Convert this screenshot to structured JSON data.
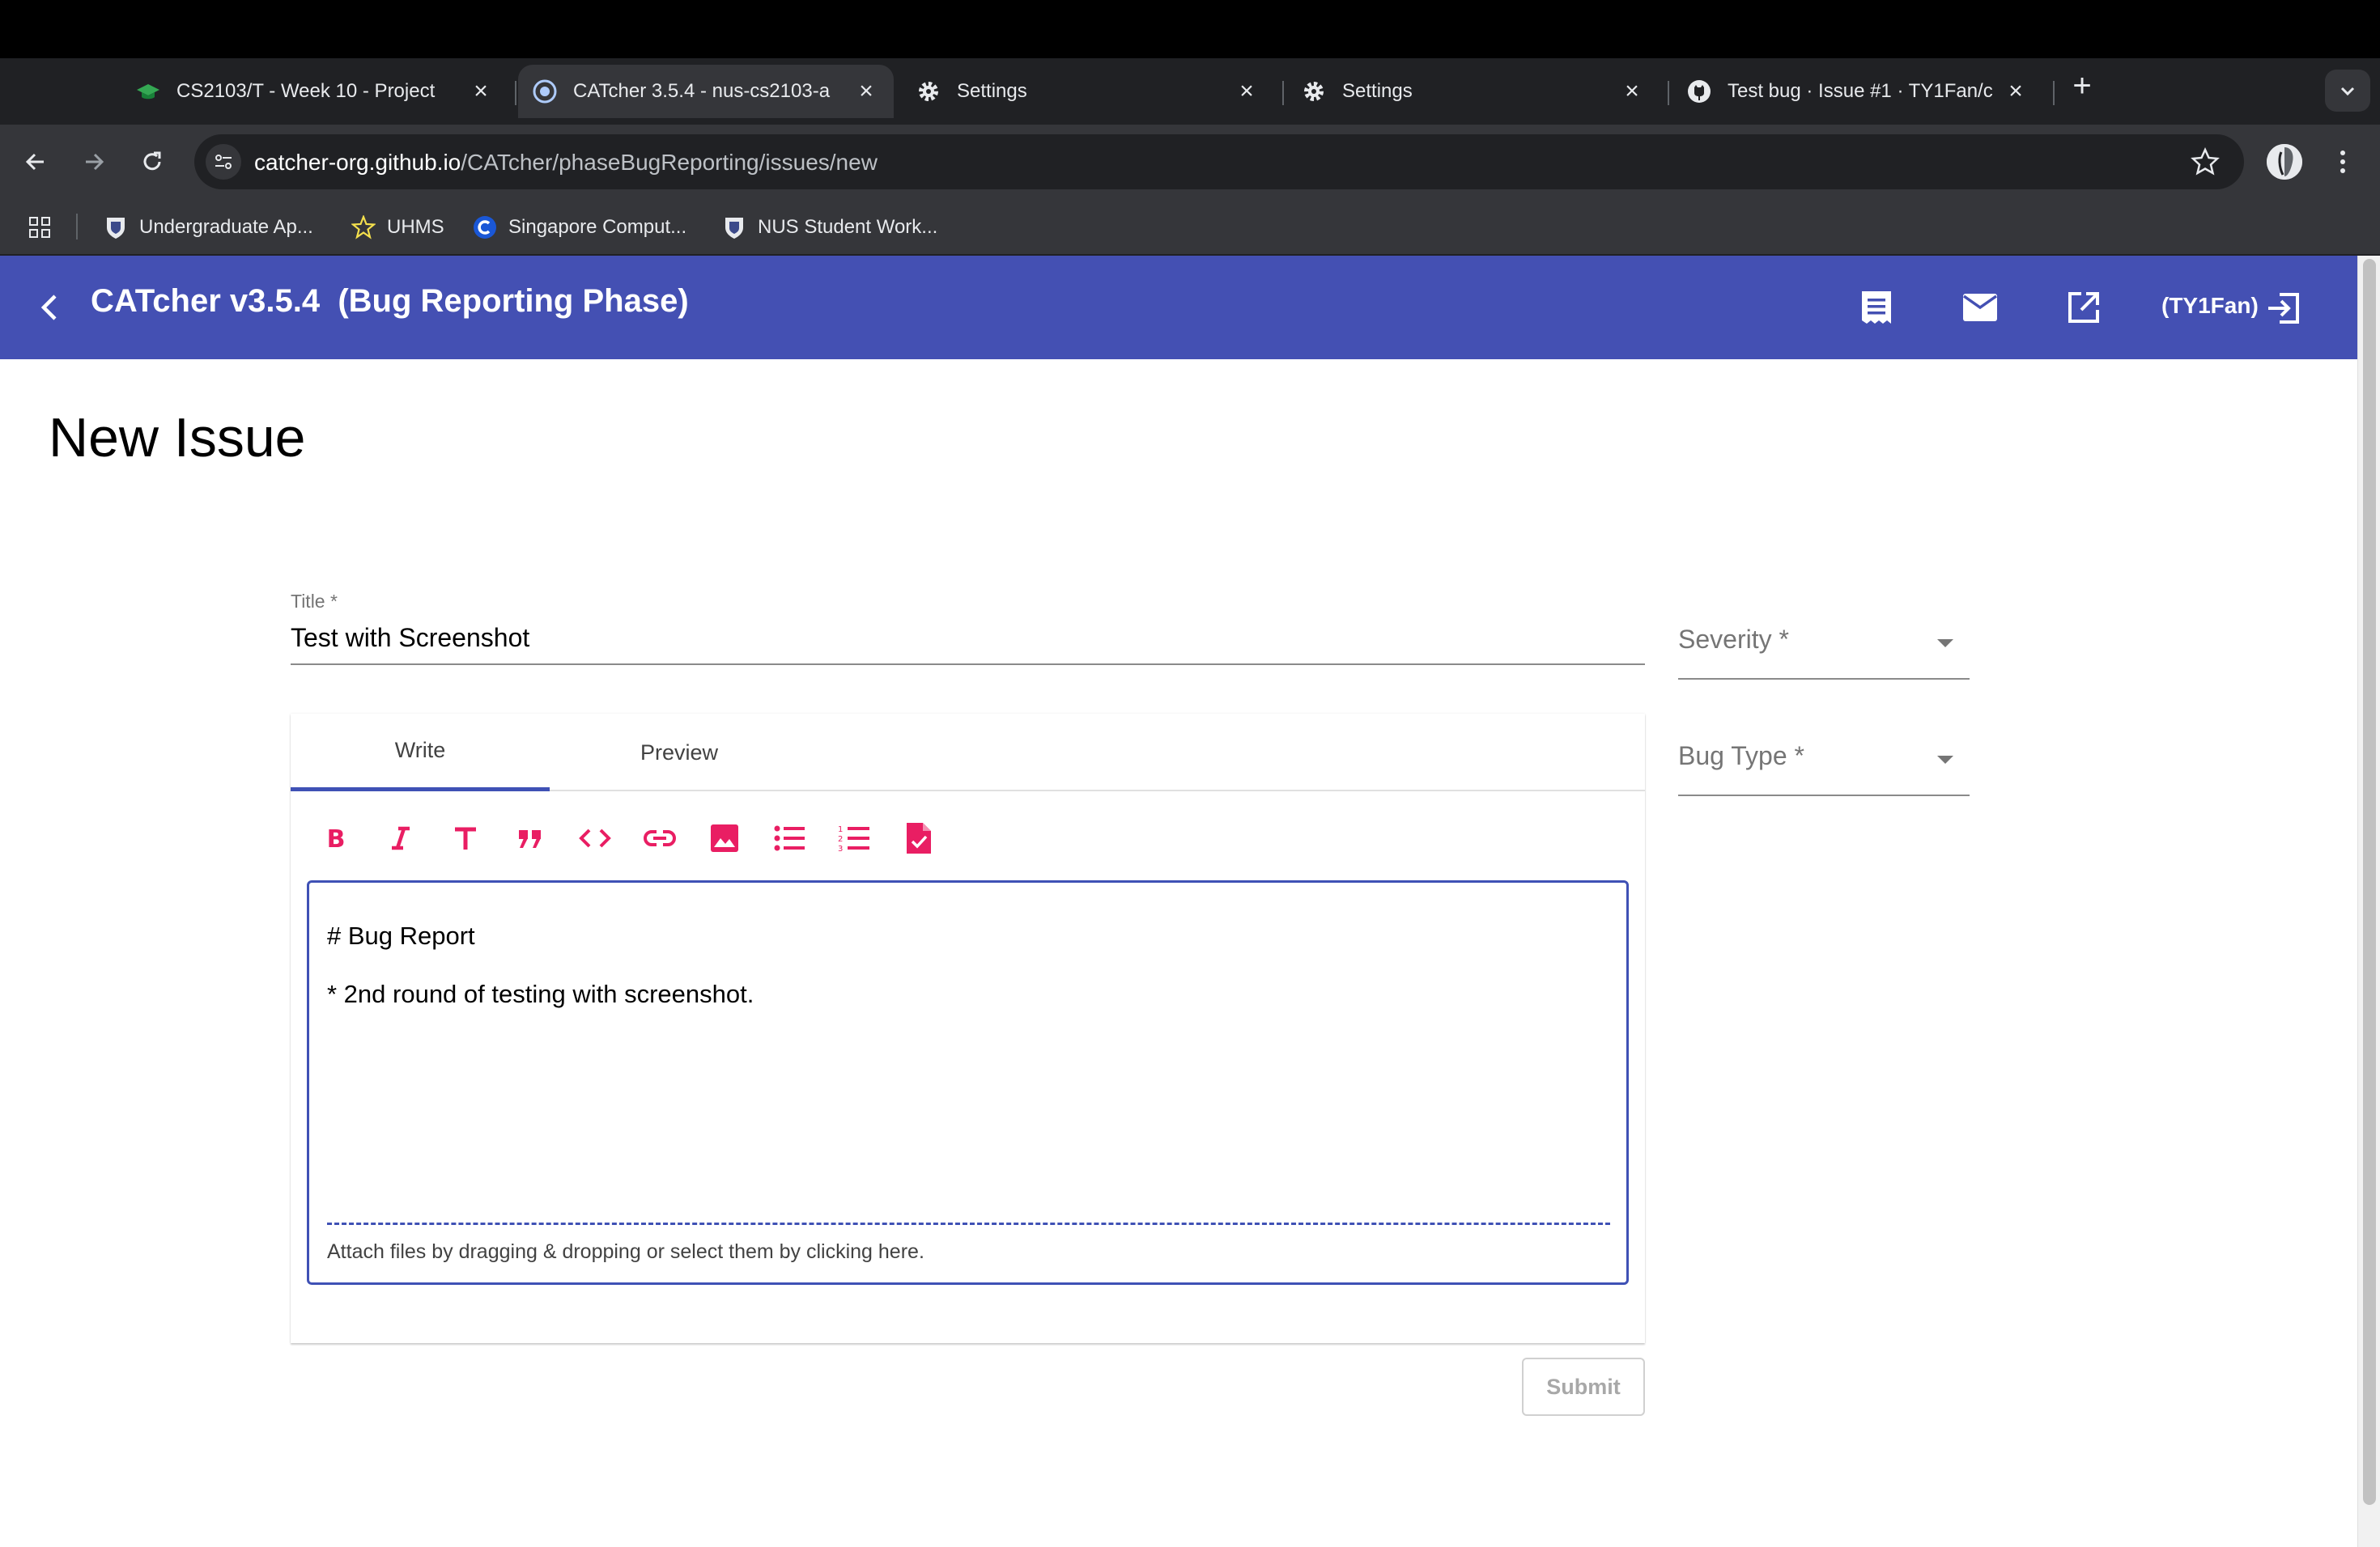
{
  "browser": {
    "tabs": [
      {
        "title": "CS2103/T - Week 10 - Project",
        "icon": "graduation-cap-icon",
        "active": false
      },
      {
        "title": "CATcher 3.5.4 - nus-cs2103-a",
        "icon": "catcher-icon",
        "active": true
      },
      {
        "title": "Settings",
        "icon": "gear-icon",
        "active": false
      },
      {
        "title": "Settings",
        "icon": "gear-icon",
        "active": false
      },
      {
        "title": "Test bug · Issue #1 · TY1Fan/c",
        "icon": "github-icon",
        "active": false
      }
    ],
    "new_tab_glyph": "+",
    "close_glyph": "×",
    "url_host": "catcher-org.github.io",
    "url_path": "/CATcher/phaseBugReporting/issues/new",
    "bookmarks": [
      {
        "label": "Undergraduate Ap...",
        "icon": "nus-crest-icon"
      },
      {
        "label": "UHMS",
        "icon": "star-icon"
      },
      {
        "label": "Singapore Comput...",
        "icon": "c-logo-icon"
      },
      {
        "label": "NUS Student Work...",
        "icon": "nus-crest-icon"
      }
    ]
  },
  "app": {
    "title": "CATcher v3.5.4  (Bug Reporting Phase)",
    "user": "(TY1Fan)",
    "header_color": "#4450b3",
    "accent_color": "#3f51b5",
    "icon_color": "#e91e63"
  },
  "page": {
    "heading": "New Issue"
  },
  "form": {
    "title_label": "Title *",
    "title_value": "Test with Screenshot",
    "severity_placeholder": "Severity *",
    "bug_type_placeholder": "Bug Type *",
    "tabs": [
      "Write",
      "Preview"
    ],
    "active_tab": "Write",
    "toolbar_icons": [
      "bold-icon",
      "italic-icon",
      "heading-icon",
      "quote-icon",
      "code-icon",
      "link-icon",
      "image-icon",
      "bulleted-list-icon",
      "numbered-list-icon",
      "task-list-icon"
    ],
    "body_lines": [
      "# Bug Report",
      "* 2nd round of testing with screenshot."
    ],
    "attach_hint": "Attach files by dragging & dropping or select them by clicking here.",
    "submit_label": "Submit"
  }
}
